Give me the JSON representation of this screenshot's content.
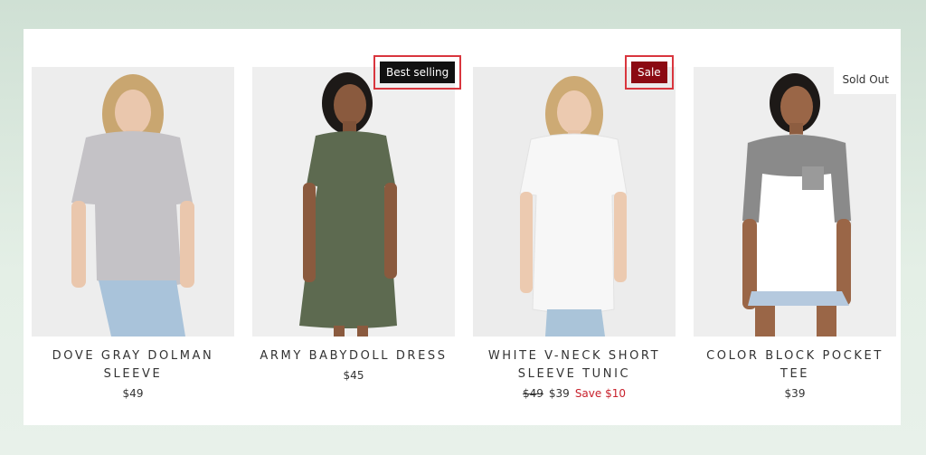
{
  "products": [
    {
      "title": "DOVE GRAY DOLMAN SLEEVE",
      "price": "$49",
      "garment_color": "#c4c2c6"
    },
    {
      "title": "ARMY BABYDOLL DRESS",
      "price": "$45",
      "badge": "Best selling",
      "garment_color": "#5d6a50"
    },
    {
      "title": "WHITE V-NECK SHORT SLEEVE TUNIC",
      "old_price": "$49",
      "price": "$39",
      "save": "Save $10",
      "badge": "Sale",
      "garment_color": "#f7f7f7"
    },
    {
      "title": "COLOR BLOCK POCKET TEE",
      "price": "$39",
      "badge": "Sold Out",
      "garment_color": "#ffffff",
      "accent_color": "#8a8a8a"
    }
  ],
  "colors": {
    "background": "#d8e7dc",
    "sale_badge": "#8b0a12",
    "best_badge": "#111111",
    "save_text": "#c8212c",
    "highlight_border": "#d9363e"
  }
}
